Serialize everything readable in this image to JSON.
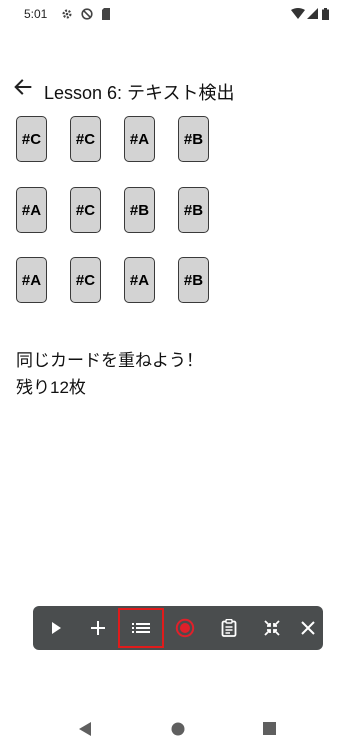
{
  "status_bar": {
    "time": "5:01",
    "icons": [
      "settings-icon",
      "no-entry-icon",
      "sd-card-icon",
      "wifi-icon",
      "signal-icon",
      "battery-icon"
    ]
  },
  "app_bar": {
    "title": "Lesson 6: テキスト検出",
    "back_icon": "arrow-left-icon"
  },
  "cards": {
    "rows": [
      [
        "#C",
        "#C",
        "#A",
        "#B"
      ],
      [
        "#A",
        "#C",
        "#B",
        "#B"
      ],
      [
        "#A",
        "#C",
        "#A",
        "#B"
      ]
    ],
    "fill_color": "#d3d3d3"
  },
  "instruction": "同じカードを重ねよう！",
  "remaining": "残り12枚",
  "toolbar": {
    "buttons": [
      "play-icon",
      "add-icon",
      "list-icon",
      "record-icon",
      "clipboard-icon",
      "collapse-icon",
      "close-icon"
    ],
    "highlighted": "list-icon",
    "highlight_color": "#e01b1b",
    "record_color": "#e0202a"
  },
  "nav_bar": {
    "buttons": [
      "back-triangle-icon",
      "home-circle-icon",
      "recents-square-icon"
    ]
  }
}
